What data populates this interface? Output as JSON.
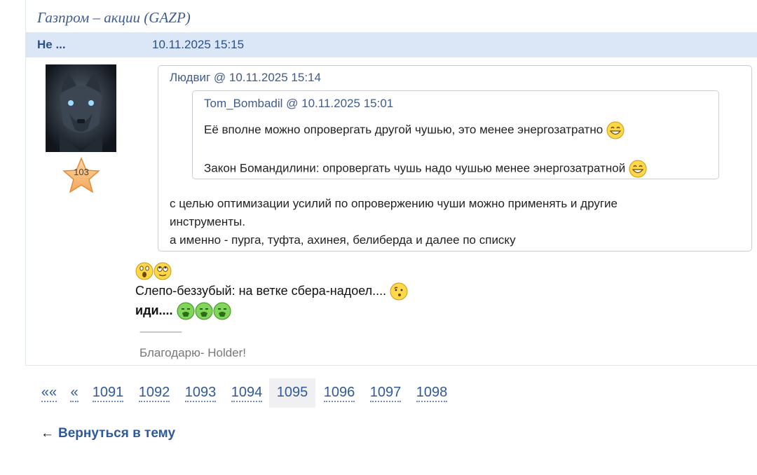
{
  "topic": {
    "title": "Газпром – акции (GAZP)"
  },
  "post": {
    "author": "Не ...",
    "date": "10.11.2025 15:15",
    "rating": "103",
    "quote_outer": {
      "header": "Людвиг @ 10.11.2025 15:14",
      "quote_inner": {
        "header": "Tom_Bombadil @ 10.11.2025 15:01",
        "line1": "Её вполне можно опровергать другой чушью, это менее энергозатратно",
        "line2": "Закон Бомандилини: опровергать чушь надо чушью менее энергозатратной"
      },
      "body": [
        "с целью оптимизации усилий по опровержению чуши можно применять и другие",
        "инструменты.",
        "а именно - пурга, туфта, ахинея, белиберда и далее по списку"
      ]
    },
    "reply_line1": "Слепо-беззубый: на ветке сбера-надоел....",
    "reply_line2": "иди....",
    "signature_separator": "--------------------",
    "signature": "Благодарю- Holder!"
  },
  "pagination": {
    "first": "««",
    "prev": "«",
    "pages": [
      "1091",
      "1092",
      "1093",
      "1094",
      "1095",
      "1096",
      "1097",
      "1098"
    ],
    "current": "1095"
  },
  "back_link": {
    "arrow": "←",
    "label": "Вернуться в тему"
  },
  "colors": {
    "accent": "#2f5a9a",
    "header_bg": "#dbe7f7",
    "quote_border": "#c9ced4"
  }
}
